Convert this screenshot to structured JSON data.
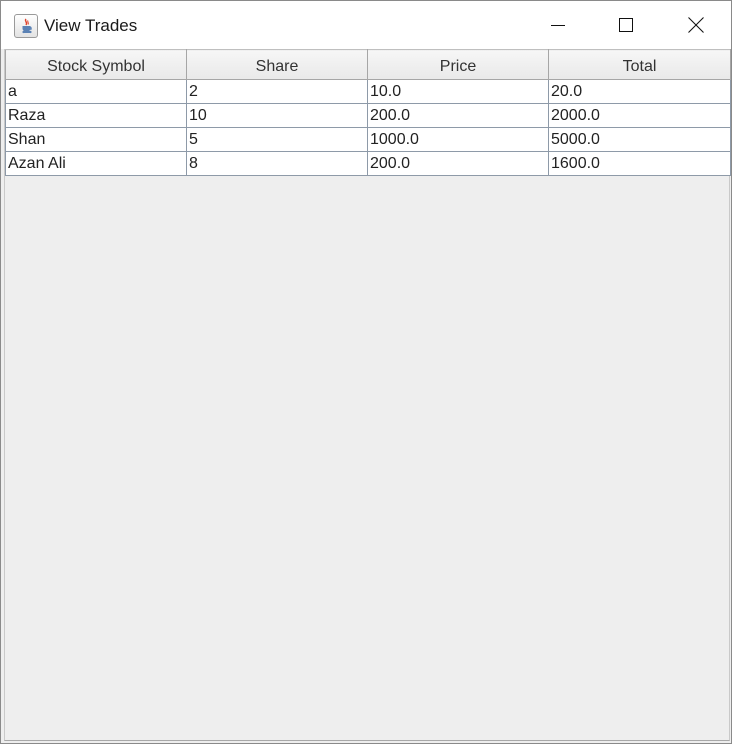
{
  "window": {
    "title": "View Trades",
    "icons": {
      "app": "java-cup-icon",
      "minimize": "minimize-icon",
      "maximize": "maximize-icon",
      "close": "close-icon"
    }
  },
  "table": {
    "headers": [
      "Stock Symbol",
      "Share",
      "Price",
      "Total"
    ],
    "rows": [
      [
        "a",
        "2",
        "10.0",
        "20.0"
      ],
      [
        "Raza",
        "10",
        "200.0",
        "2000.0"
      ],
      [
        "Shan",
        "5",
        "1000.0",
        "5000.0"
      ],
      [
        "Azan Ali",
        "8",
        "200.0",
        "1600.0"
      ]
    ]
  }
}
